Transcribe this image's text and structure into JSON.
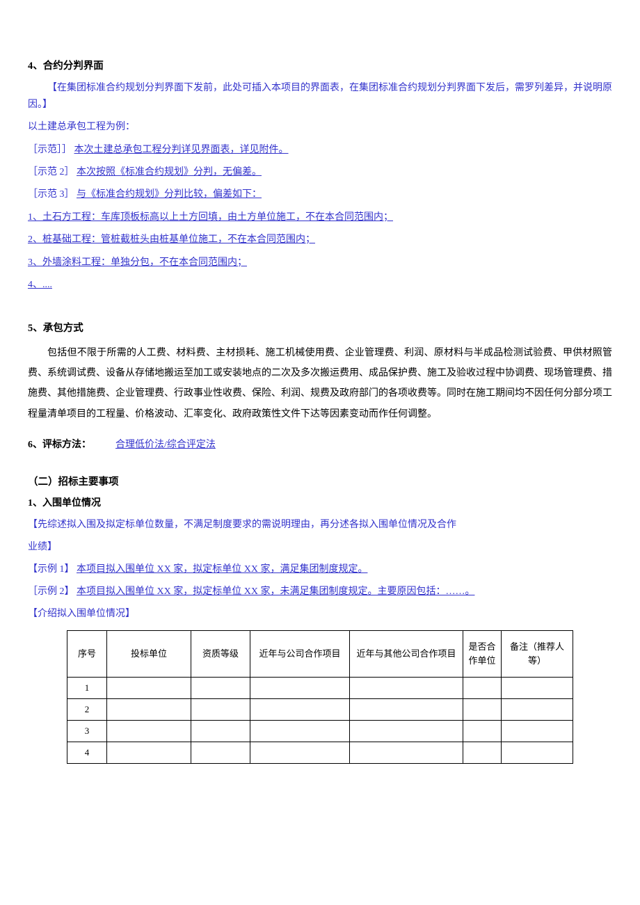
{
  "section4": {
    "title": "4、合约分判界面",
    "note": "【在集团标准合约规划分判界面下发前，此处可插入本项目的界面表，在集团标准合约规划分判界面下发后，需罗列差异，并说明原因。】",
    "intro": "以土建总承包工程为例：",
    "ex1_label": "［示范］］",
    "ex1_text": "本次土建总承包工程分判详见界面表，详见附件。",
    "ex2_label": "［示范 2］",
    "ex2_text": "本次按照《标准合约规划》分判，无偏差。",
    "ex3_label": "［示范 3］",
    "ex3_text": "与《标准合约规划》分判比较，偏差如下：",
    "item1": "1、土石方工程：车库顶板标高以上土方回填，由土方单位施工，不在本合同范围内；",
    "item2": "2、桩基础工程：管桩截桩头由桩基单位施工，不在本合同范围内；",
    "item3": "3、外墙涂料工程：单独分包，不在本合同范围内；",
    "item4": "4、...."
  },
  "section5": {
    "title": "5、承包方式",
    "body": "包括但不限于所需的人工费、材料费、主材损耗、施工机械使用费、企业管理费、利润、原材料与半成品检测试验费、甲供材照管费、系统调试费、设备从存储地搬运至加工或安装地点的二次及多次搬运费用、成品保护费、施工及验收过程中协调费、现场管理费、措施费、其他措施费、企业管理费、行政事业性收费、保险、利润、规费及政府部门的各项收费等。同时在施工期间均不因任何分部分项工程量清单项目的工程量、价格波动、汇率变化、政府政策性文件下达等因素变动而作任何调整。"
  },
  "section6": {
    "title": "6、评标方法：",
    "value": "合理低价法/综合评定法"
  },
  "sectionB": {
    "title": "（二）招标主要事项",
    "sub1_title": "1、入围单位情况",
    "note1": "【先综述拟入围及拟定标单位数量，不满足制度要求的需说明理由，再分述各拟入围单位情况及合作",
    "note2": "业绩】",
    "ex1_label": "【示例 1】",
    "ex1_text": "本项目拟入围单位 XX 家，拟定标单位 XX 家，满足集团制度规定。",
    "ex2_label": "［示例 2】",
    "ex2_text": "本项目拟入围单位 XX 家，拟定标单位 XX 家，未满足集团制度规定。主要原因包括：……。",
    "note3": "【介绍拟入围单位情况】"
  },
  "table": {
    "headers": {
      "c1": "序号",
      "c2": "投标单位",
      "c3": "资质等级",
      "c4": "近年与公司合作项目",
      "c5": "近年与其他公司合作项目",
      "c6": "是否合作单位",
      "c7": "备注（推荐人等）"
    },
    "rows": [
      "1",
      "2",
      "3",
      "4"
    ]
  }
}
